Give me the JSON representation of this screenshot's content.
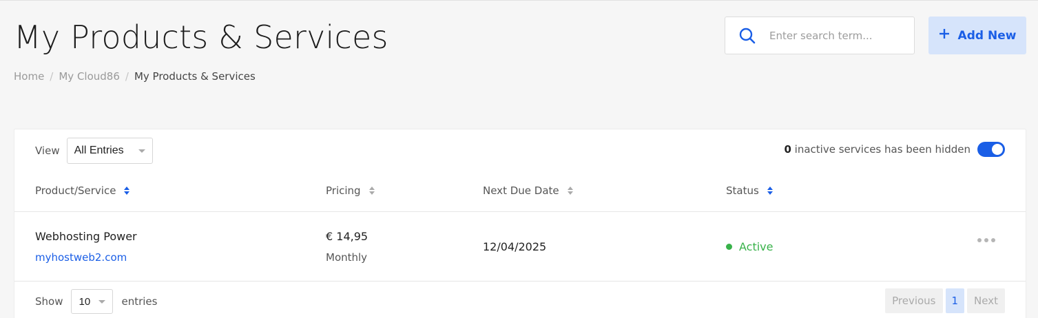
{
  "header": {
    "title": "My Products & Services",
    "breadcrumb": [
      "Home",
      "My Cloud86",
      "My Products & Services"
    ],
    "search_placeholder": "Enter search term...",
    "add_new_label": "Add New"
  },
  "toolbar": {
    "view_label": "View",
    "view_value": "All Entries",
    "inactive_count": "0",
    "inactive_text": "inactive services has been hidden",
    "inactive_toggle_on": true
  },
  "table": {
    "columns": [
      "Product/Service",
      "Pricing",
      "Next Due Date",
      "Status"
    ],
    "rows": [
      {
        "product": "Webhosting Power",
        "domain": "myhostweb2.com",
        "price": "€ 14,95",
        "cycle": "Monthly",
        "due_date": "12/04/2025",
        "status": "Active"
      }
    ]
  },
  "footer": {
    "show_label": "Show",
    "entries_value": "10",
    "entries_label": "entries",
    "previous_label": "Previous",
    "page": "1",
    "next_label": "Next"
  },
  "colors": {
    "accent": "#1a5ee6",
    "active": "#38b24a",
    "accent_soft": "#d6e4fb"
  }
}
